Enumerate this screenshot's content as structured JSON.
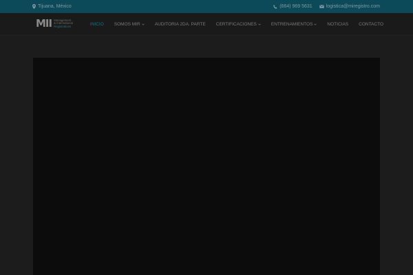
{
  "topbar": {
    "location": "Tijuana, México",
    "phone": "(664) 969 5631",
    "email": "logistica@miregistro.com",
    "location_icon": "map-pin-icon",
    "phone_icon": "phone-icon",
    "email_icon": "envelope-icon"
  },
  "logo": {
    "mark": "MII",
    "line1": "Management",
    "line2": "& International",
    "line3": "Registrations"
  },
  "nav": {
    "items": [
      {
        "label": "INICIO",
        "active": true
      },
      {
        "label": "SOMOS MIR",
        "dropdown": true
      },
      {
        "label": "AUDITORIA 2DA. PARTE"
      },
      {
        "label": "CERTIFICACIONES",
        "dropdown": true
      },
      {
        "label": "ENTRENAMIENTOS",
        "dropdown": true
      },
      {
        "label": "NOTICIAS"
      },
      {
        "label": "CONTACTO"
      }
    ]
  },
  "colors": {
    "topbar_bg": "#0c4a59",
    "accent": "#1a6f86",
    "page_bg": "#1c1c1c",
    "hero_bg": "#0c0c0c"
  }
}
